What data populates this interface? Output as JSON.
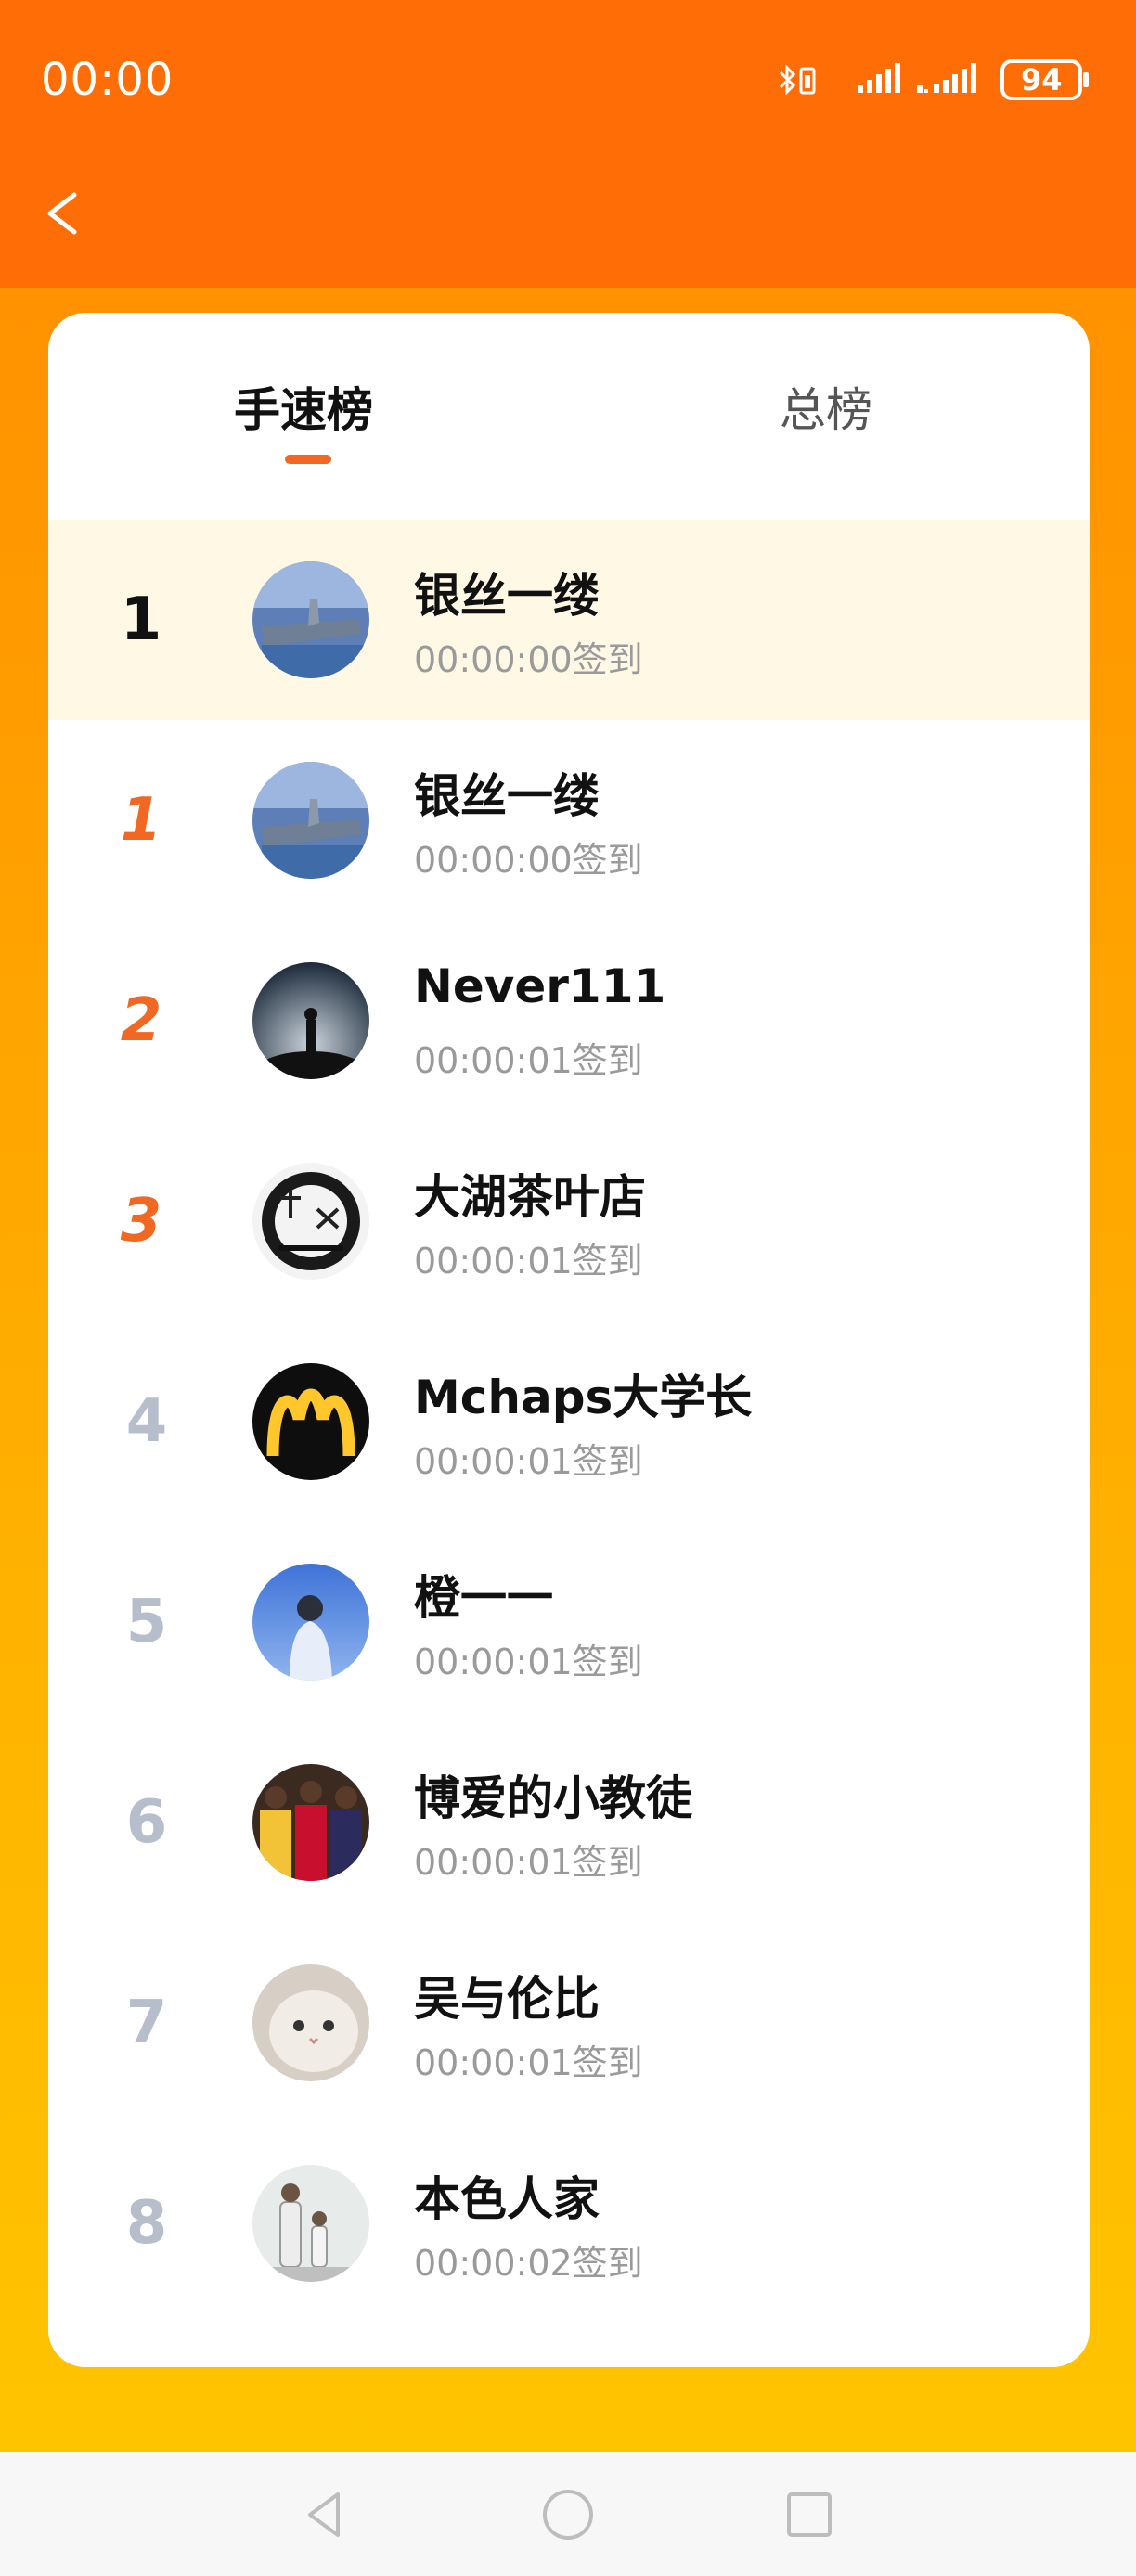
{
  "status_bar": {
    "time": "00:00",
    "battery": "94",
    "icons": [
      "bluetooth-icon",
      "vibrate-icon",
      "signal-icon",
      "signal-icon",
      "battery-icon"
    ]
  },
  "header": {
    "back_icon": "chevron-left-icon"
  },
  "tabs": [
    {
      "label": "手速榜",
      "active": true
    },
    {
      "label": "总榜",
      "active": false
    }
  ],
  "ranking": [
    {
      "rank": "1",
      "name": "银丝一缕",
      "time": "00:00:00签到",
      "highlight": true,
      "avatar": "aircraft-carrier"
    },
    {
      "rank": "1",
      "name": "银丝一缕",
      "time": "00:00:00签到",
      "avatar": "aircraft-carrier"
    },
    {
      "rank": "2",
      "name": "Never111",
      "time": "00:00:01签到",
      "avatar": "person-silhouette-night"
    },
    {
      "rank": "3",
      "name": "大湖茶叶店",
      "time": "00:00:01签到",
      "avatar": "calligraphy-ink"
    },
    {
      "rank": "4",
      "name": "Mchaps大学长",
      "time": "00:00:01签到",
      "avatar": "golden-arches"
    },
    {
      "rank": "5",
      "name": "橙一一",
      "time": "00:00:01签到",
      "avatar": "girl-blue-sky"
    },
    {
      "rank": "6",
      "name": "博爱的小教徒",
      "time": "00:00:01签到",
      "avatar": "basketball-players"
    },
    {
      "rank": "7",
      "name": "吴与伦比",
      "time": "00:00:01签到",
      "avatar": "white-cat"
    },
    {
      "rank": "8",
      "name": "本色人家",
      "time": "00:00:02签到",
      "avatar": "family-photo"
    }
  ],
  "colors": {
    "header": "#FF6D07",
    "accent": "#F26722",
    "highlight_row": "#FEF8E5",
    "rank_grey": "#B7BECB",
    "subtext": "#9A9A9A"
  },
  "navbar": {
    "icons": [
      "back-triangle-icon",
      "home-circle-icon",
      "recents-square-icon"
    ]
  }
}
